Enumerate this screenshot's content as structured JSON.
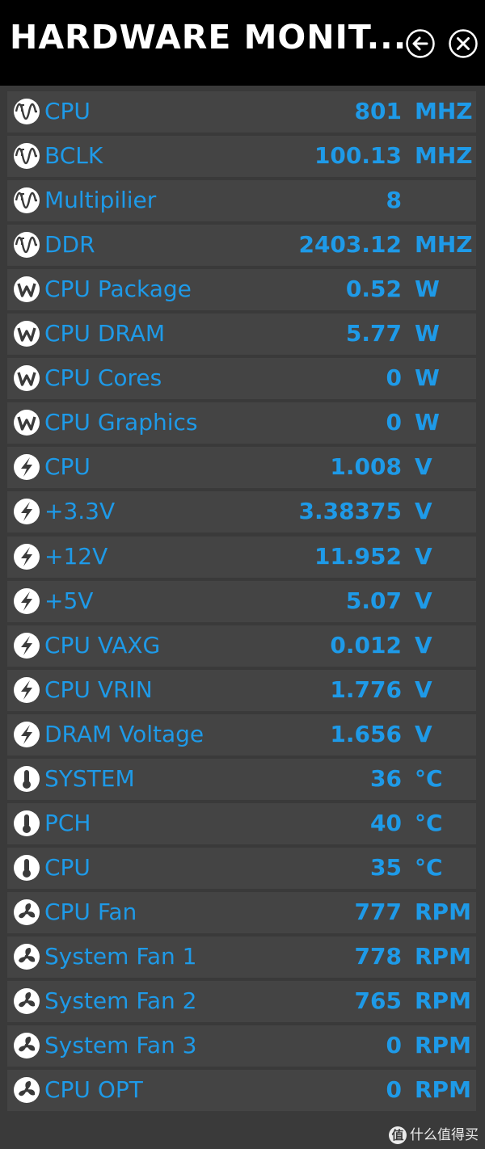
{
  "window": {
    "title": "HARDWARE MONIT...",
    "back_icon": "back-arrow-icon",
    "close_icon": "close-icon"
  },
  "colors": {
    "accent": "#1e9ae8",
    "row_bg": "#444444",
    "window_bg": "#3a3a3a",
    "titlebar_bg": "#000000"
  },
  "sensors": [
    {
      "icon": "frequency-icon",
      "label": "CPU",
      "value": "801",
      "unit": "MHZ"
    },
    {
      "icon": "frequency-icon",
      "label": "BCLK",
      "value": "100.13",
      "unit": "MHZ"
    },
    {
      "icon": "frequency-icon",
      "label": "Multipilier",
      "value": "8",
      "unit": ""
    },
    {
      "icon": "frequency-icon",
      "label": "DDR",
      "value": "2403.12",
      "unit": "MHZ"
    },
    {
      "icon": "power-watt-icon",
      "label": "CPU Package",
      "value": "0.52",
      "unit": "W"
    },
    {
      "icon": "power-watt-icon",
      "label": "CPU DRAM",
      "value": "5.77",
      "unit": "W"
    },
    {
      "icon": "power-watt-icon",
      "label": "CPU Cores",
      "value": "0",
      "unit": "W"
    },
    {
      "icon": "power-watt-icon",
      "label": "CPU Graphics",
      "value": "0",
      "unit": "W"
    },
    {
      "icon": "voltage-bolt-icon",
      "label": "CPU",
      "value": "1.008",
      "unit": "V"
    },
    {
      "icon": "voltage-bolt-icon",
      "label": "+3.3V",
      "value": "3.38375",
      "unit": "V"
    },
    {
      "icon": "voltage-bolt-icon",
      "label": "+12V",
      "value": "11.952",
      "unit": "V"
    },
    {
      "icon": "voltage-bolt-icon",
      "label": "+5V",
      "value": "5.07",
      "unit": "V"
    },
    {
      "icon": "voltage-bolt-icon",
      "label": "CPU VAXG",
      "value": "0.012",
      "unit": "V"
    },
    {
      "icon": "voltage-bolt-icon",
      "label": "CPU VRIN",
      "value": "1.776",
      "unit": "V"
    },
    {
      "icon": "voltage-bolt-icon",
      "label": "DRAM Voltage",
      "value": "1.656",
      "unit": "V"
    },
    {
      "icon": "thermometer-icon",
      "label": "SYSTEM",
      "value": "36",
      "unit": "°C"
    },
    {
      "icon": "thermometer-icon",
      "label": "PCH",
      "value": "40",
      "unit": "°C"
    },
    {
      "icon": "thermometer-icon",
      "label": "CPU",
      "value": "35",
      "unit": "°C"
    },
    {
      "icon": "fan-icon",
      "label": "CPU Fan",
      "value": "777",
      "unit": "RPM"
    },
    {
      "icon": "fan-icon",
      "label": "System Fan 1",
      "value": "778",
      "unit": "RPM"
    },
    {
      "icon": "fan-icon",
      "label": "System Fan 2",
      "value": "765",
      "unit": "RPM"
    },
    {
      "icon": "fan-icon",
      "label": "System Fan 3",
      "value": "0",
      "unit": "RPM"
    },
    {
      "icon": "fan-icon",
      "label": "CPU OPT",
      "value": "0",
      "unit": "RPM"
    }
  ],
  "watermark": {
    "badge": "值",
    "text": "什么值得买"
  }
}
